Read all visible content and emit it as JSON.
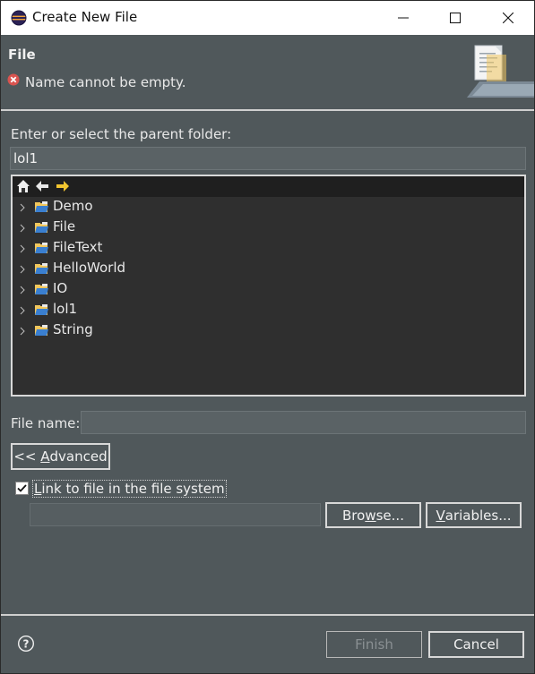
{
  "window": {
    "title": "Create New File",
    "app_icon": "eclipse-icon",
    "controls": [
      "minimize-icon",
      "maximize-icon",
      "close-icon"
    ]
  },
  "header": {
    "title": "File",
    "error_icon": "error-icon",
    "message": "Name cannot be empty.",
    "banner_icon": "new-file-wizard-icon"
  },
  "parent_folder": {
    "label": "Enter or select the parent folder:",
    "value": "lol1"
  },
  "tree": {
    "toolbar_icons": [
      "home-icon",
      "back-arrow-icon",
      "forward-arrow-icon"
    ],
    "items": [
      {
        "label": "Demo"
      },
      {
        "label": "File"
      },
      {
        "label": "FileText"
      },
      {
        "label": "HelloWorld"
      },
      {
        "label": "IO"
      },
      {
        "label": "lol1"
      },
      {
        "label": "String"
      }
    ]
  },
  "file_name": {
    "label": "File name:",
    "value": ""
  },
  "advanced_button": {
    "prefix": "<< ",
    "mnemonic": "A",
    "rest": "dvanced"
  },
  "link_checkbox": {
    "checked": true,
    "mnemonic": "L",
    "rest": "ink to file in the file system"
  },
  "link_path": {
    "value": ""
  },
  "browse_button": {
    "pre": "Bro",
    "mnemonic": "w",
    "post": "se..."
  },
  "variables_button": {
    "mnemonic": "V",
    "rest": "ariables..."
  },
  "footer": {
    "help_icon": "help-icon",
    "finish_label": "Finish",
    "cancel_label": "Cancel"
  },
  "colors": {
    "dialog_bg": "#50585b",
    "tree_bg": "#2f2f2f",
    "error_red": "#d9534f",
    "folder_blue": "#3a7fd0"
  }
}
